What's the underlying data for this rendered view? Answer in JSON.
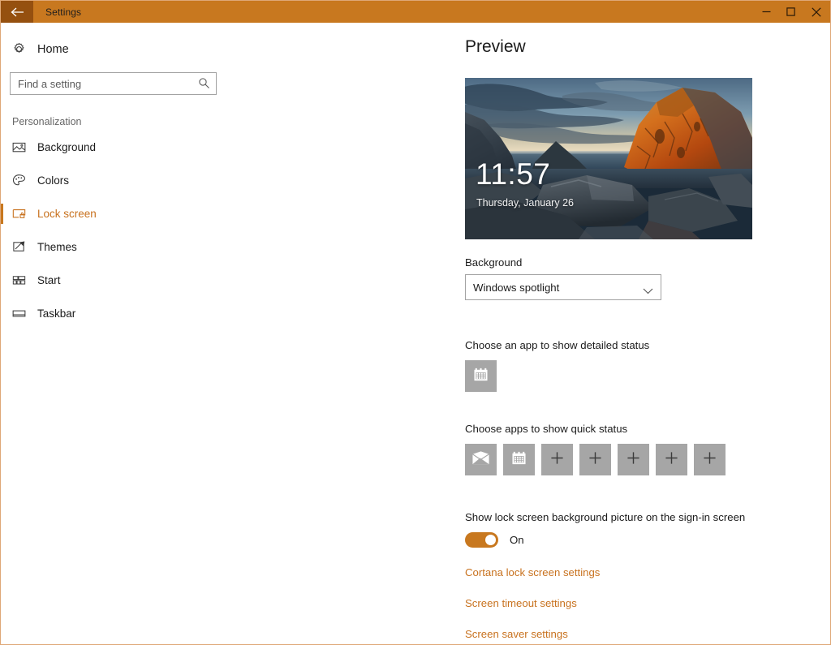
{
  "window": {
    "title": "Settings",
    "back_icon": "back-arrow-icon",
    "controls": {
      "minimize": "minimize-icon",
      "maximize": "maximize-icon",
      "close": "close-icon"
    },
    "titlebar_color": "#c8781f",
    "back_button_color": "#95500f",
    "accent_color": "#c8721f",
    "border_color": "#dfa877"
  },
  "sidebar": {
    "home": {
      "label": "Home",
      "icon": "gear-icon"
    },
    "search": {
      "placeholder": "Find a setting",
      "value": "",
      "icon": "search-icon"
    },
    "group_label": "Personalization",
    "items": [
      {
        "label": "Background",
        "icon": "picture-icon",
        "selected": false
      },
      {
        "label": "Colors",
        "icon": "palette-icon",
        "selected": false
      },
      {
        "label": "Lock screen",
        "icon": "lock-screen-icon",
        "selected": true
      },
      {
        "label": "Themes",
        "icon": "themes-brush-icon",
        "selected": false
      },
      {
        "label": "Start",
        "icon": "start-tiles-icon",
        "selected": false
      },
      {
        "label": "Taskbar",
        "icon": "taskbar-icon",
        "selected": false
      }
    ]
  },
  "main": {
    "page_title": "Preview",
    "preview": {
      "time": "11:57",
      "date": "Thursday, January 26",
      "image_description": "coastal rocks at sunset with orange sunlit cliff"
    },
    "background_section": {
      "label": "Background",
      "selected_option": "Windows spotlight",
      "chevron_icon": "chevron-down-icon"
    },
    "detailed_status": {
      "label": "Choose an app to show detailed status",
      "tiles": [
        {
          "icon": "calendar-icon",
          "type": "app"
        }
      ]
    },
    "quick_status": {
      "label": "Choose apps to show quick status",
      "tiles": [
        {
          "icon": "mail-icon",
          "type": "app"
        },
        {
          "icon": "calendar-icon",
          "type": "app"
        },
        {
          "icon": "plus-icon",
          "type": "empty"
        },
        {
          "icon": "plus-icon",
          "type": "empty"
        },
        {
          "icon": "plus-icon",
          "type": "empty"
        },
        {
          "icon": "plus-icon",
          "type": "empty"
        },
        {
          "icon": "plus-icon",
          "type": "empty"
        }
      ]
    },
    "signin_toggle": {
      "label": "Show lock screen background picture on the sign-in screen",
      "state": "On"
    },
    "links": [
      "Cortana lock screen settings",
      "Screen timeout settings",
      "Screen saver settings"
    ]
  }
}
